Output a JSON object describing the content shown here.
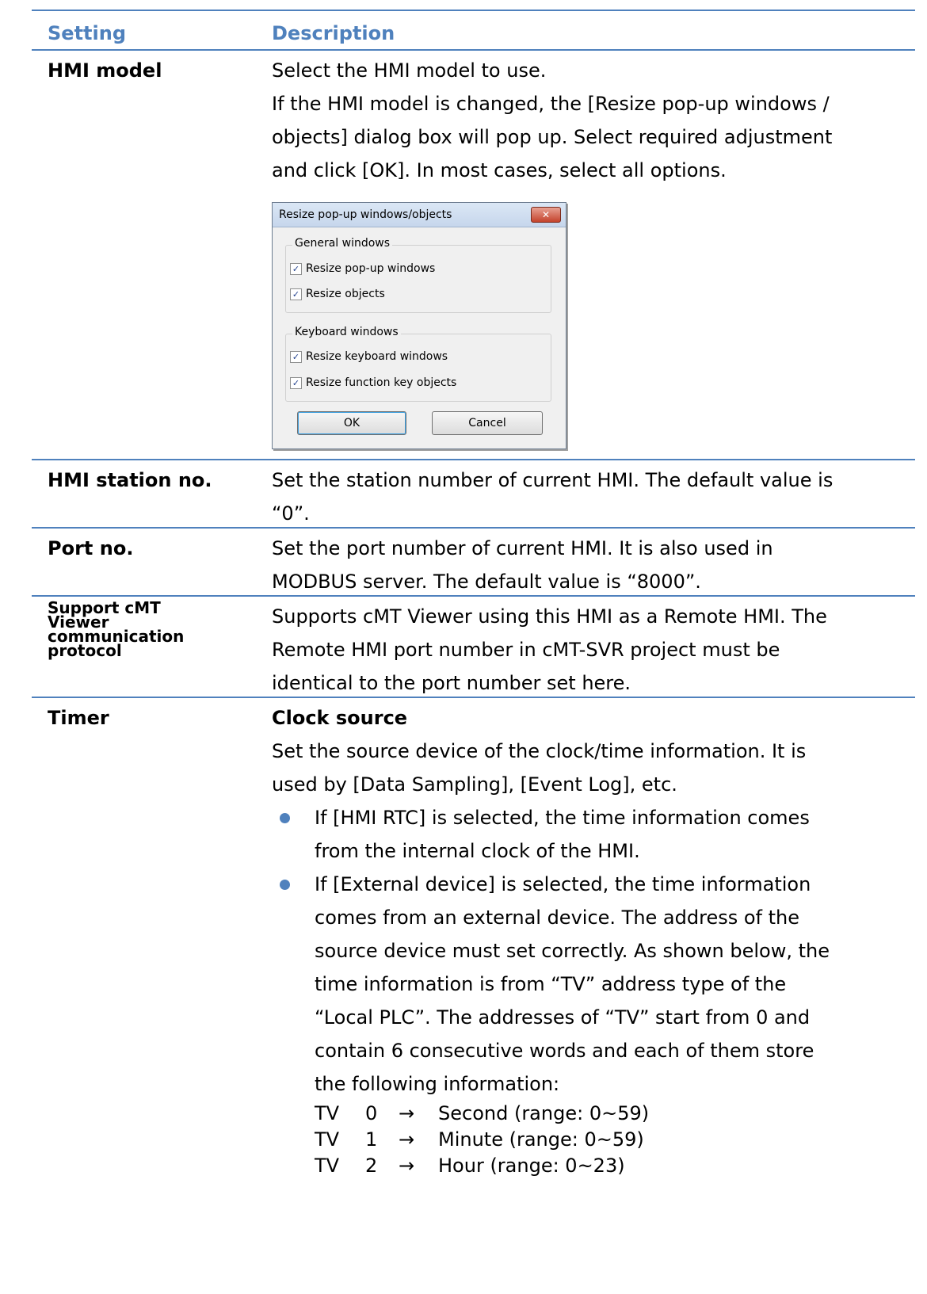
{
  "header": {
    "setting": "Setting",
    "description": "Description"
  },
  "rows": {
    "hmi_model": {
      "setting": "HMI model",
      "lines": [
        "Select the HMI model to use.",
        "If the HMI model is changed, the [Resize pop-up windows /",
        "objects] dialog box will pop up. Select required adjustment",
        "and click [OK]. In most cases, select all options."
      ]
    },
    "station": {
      "setting": "HMI station no.",
      "lines": [
        "Set the station number of current HMI. The default value is",
        "“0”."
      ]
    },
    "port": {
      "setting": "Port no.",
      "lines": [
        "Set the port number of current HMI. It is also used in",
        "MODBUS server. The default value is “8000”."
      ]
    },
    "cmt": {
      "setting": [
        "Support cMT",
        "Viewer",
        "communication",
        "protocol"
      ],
      "lines": [
        "Supports cMT Viewer using this HMI as a Remote HMI. The",
        "Remote HMI port number in cMT-SVR project must be",
        "identical to the port number set here."
      ]
    },
    "timer": {
      "setting": "Timer",
      "heading": "Clock source",
      "lines": [
        "Set the source device of the clock/time information. It is",
        "used by [Data Sampling], [Event Log], etc."
      ],
      "bullet1": [
        "If [HMI RTC] is selected, the time information comes",
        "from the internal clock of the HMI."
      ],
      "bullet2": [
        "If [External device] is selected, the time information",
        "comes from an external device. The address of the",
        "source device must set correctly. As shown below, the",
        "time information is from “TV” address type of the",
        "“Local PLC”. The addresses of “TV” start from 0 and",
        "contain 6 consecutive words and each of them store",
        "the following information:"
      ],
      "tv": [
        {
          "type": "TV",
          "addr": "0",
          "arrow": "→",
          "info": "Second (range: 0~59)"
        },
        {
          "type": "TV",
          "addr": "1",
          "arrow": "→",
          "info": "Minute (range: 0~59)"
        },
        {
          "type": "TV",
          "addr": "2",
          "arrow": "→",
          "info": "Hour (range: 0~23)"
        }
      ]
    }
  },
  "dialog": {
    "title": "Resize pop-up windows/objects",
    "close": "✕",
    "general_group": "General windows",
    "resize_popup": "Resize pop-up windows",
    "resize_objects": "Resize objects",
    "keyboard_group": "Keyboard windows",
    "resize_keyboard": "Resize keyboard windows",
    "resize_function_key": "Resize function key objects",
    "check": "✓",
    "ok": "OK",
    "cancel": "Cancel"
  },
  "colors": {
    "accent": "#4f81bd"
  }
}
